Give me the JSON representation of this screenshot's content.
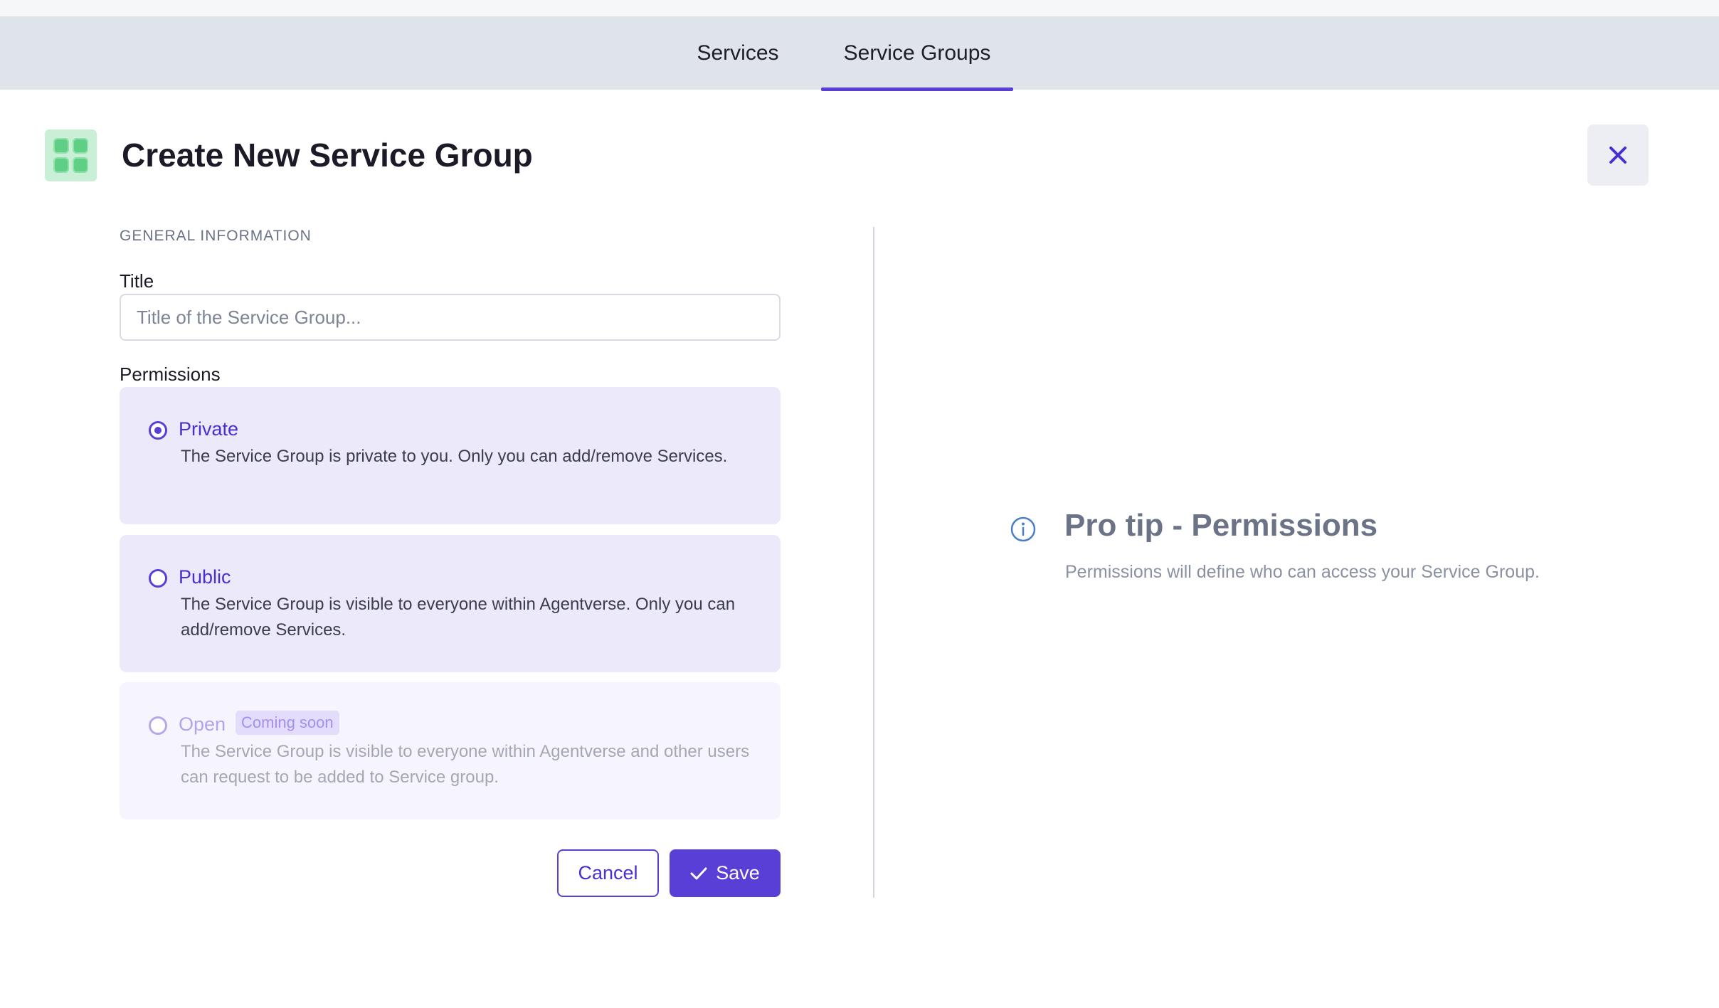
{
  "tabs": [
    {
      "label": "Services",
      "active": false
    },
    {
      "label": "Service Groups",
      "active": true
    }
  ],
  "header": {
    "title": "Create New Service Group",
    "icon": "service-group-grid-icon",
    "close_icon": "close-icon"
  },
  "form": {
    "section_label": "GENERAL INFORMATION",
    "title_label": "Title",
    "title_placeholder": "Title of the Service Group...",
    "title_value": "",
    "permissions_label": "Permissions",
    "options": [
      {
        "name": "Private",
        "description": "The Service Group is private to you. Only you can add/remove Services.",
        "selected": true,
        "disabled": false
      },
      {
        "name": "Public",
        "description": "The Service Group is visible to everyone within Agentverse. Only you can add/remove Services.",
        "selected": false,
        "disabled": false
      },
      {
        "name": "Open",
        "badge": "Coming soon",
        "description": "The Service Group is visible to everyone within Agentverse and other users can request to be added to Service group.",
        "selected": false,
        "disabled": true
      }
    ],
    "cancel_label": "Cancel",
    "save_label": "Save"
  },
  "tip": {
    "title": "Pro tip - Permissions",
    "text": "Permissions will define who can access your Service Group."
  },
  "colors": {
    "accent": "#5a3fd6",
    "tab_bar": "#dfe3ea",
    "card_bg": "#ece9fb"
  }
}
